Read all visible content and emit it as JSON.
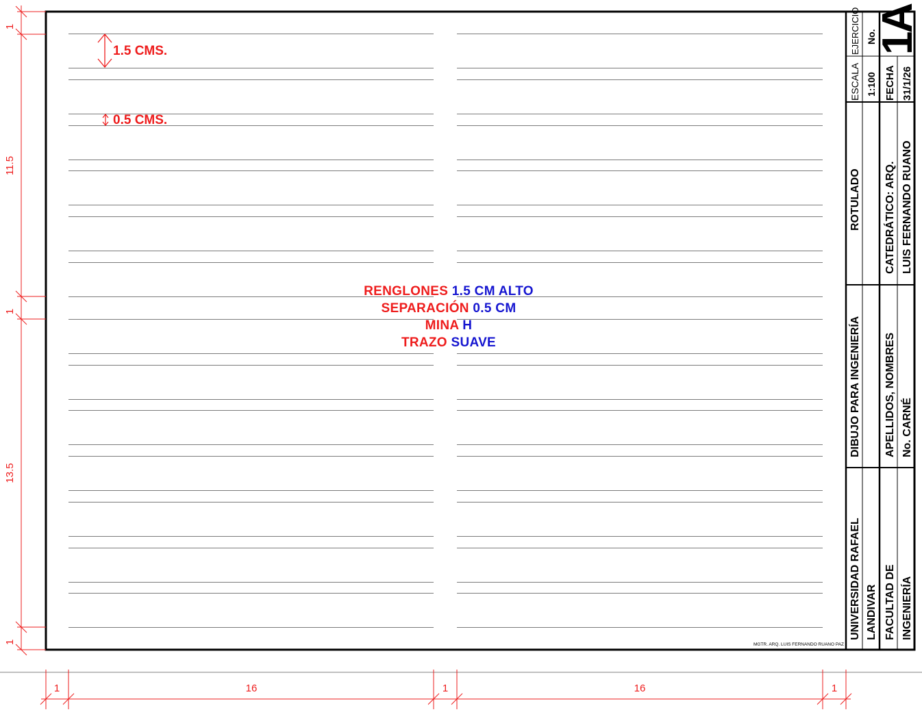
{
  "annotations": {
    "row_height": "1.5 CMS.",
    "row_gap": "0.5 CMS."
  },
  "instructions": {
    "line1_red": "RENGLONES",
    "line1_blue": "1.5 CM ALTO",
    "line2_red": "SEPARACIÓN",
    "line2_blue": "0.5 CM",
    "line3_red": "MINA",
    "line3_blue": "H",
    "line4_red": "TRAZO",
    "line4_blue": "SUAVE"
  },
  "title_block": {
    "ejercicio_label": "EJERCICIO",
    "no_label": "No.",
    "sheet_number": "1A",
    "escala_label": "ESCALA",
    "escala_value": "1:100",
    "fecha_label": "FECHA",
    "fecha_value": "31/1/26",
    "subject": "ROTULADO",
    "teacher_label": "CATEDRÁTICO: ARQ.",
    "teacher_name": "LUIS FERNANDO RUANO",
    "course": "DIBUJO PARA INGENIERÍA",
    "student_label": "APELLIDOS, NOMBRES",
    "carne_label": "No. CARNÉ",
    "university_line1": "UNIVERSIDAD RAFAEL",
    "university_line2": "LANDIVAR",
    "faculty_line1": "FACULTAD DE",
    "faculty_line2": "INGENIERÍA"
  },
  "credit": "MGTR. ARQ. LUIS FERNANDO RUANO PAZ",
  "dimensions": {
    "left": [
      "1",
      "11.5",
      "1",
      "13.5",
      "1"
    ],
    "bottom": [
      "1",
      "16",
      "1",
      "16",
      "1"
    ]
  },
  "colors": {
    "dimension_red": "#ee1c1c",
    "instruction_blue": "#1515d0",
    "rule_gray": "#7a7a7a",
    "border_black": "#000000"
  }
}
